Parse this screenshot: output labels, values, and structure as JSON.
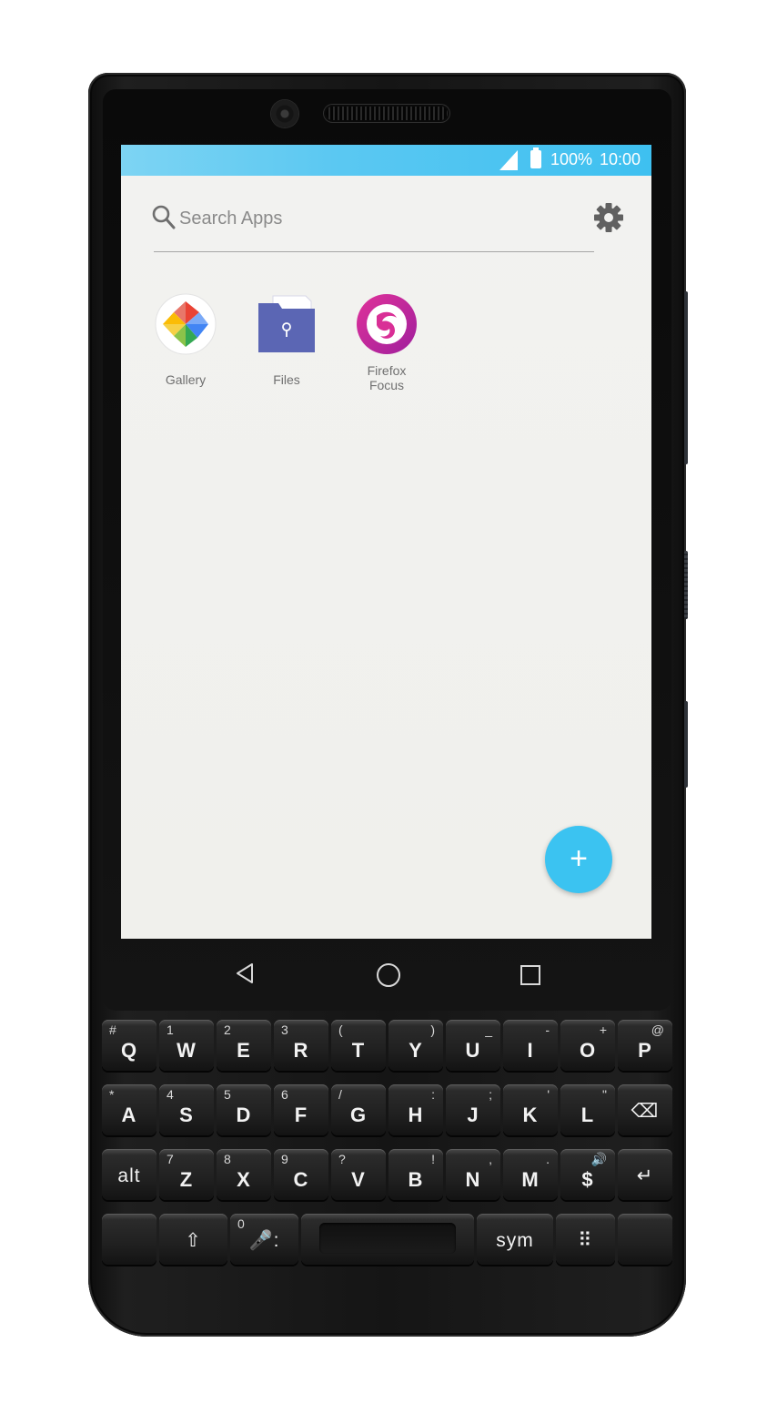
{
  "status_bar": {
    "battery_percent": "100%",
    "time": "10:00",
    "signal_icon": "signal-icon",
    "battery_icon": "battery-icon"
  },
  "search": {
    "placeholder": "Search Apps",
    "icon": "search-icon",
    "settings_icon": "gear-icon"
  },
  "apps": [
    {
      "label": "Gallery",
      "icon": "gallery-pinwheel-icon"
    },
    {
      "label": "Files",
      "icon": "folder-icon"
    },
    {
      "label": "Firefox\nFocus",
      "icon": "firefox-focus-icon"
    }
  ],
  "fab": {
    "label": "+",
    "icon": "plus-icon"
  },
  "nav": {
    "back_icon": "back-icon",
    "home_icon": "home-icon",
    "recent_icon": "recent-apps-icon"
  },
  "keyboard": {
    "row1": [
      {
        "main": "Q",
        "sec": "#"
      },
      {
        "main": "W",
        "sec": "1"
      },
      {
        "main": "E",
        "sec": "2"
      },
      {
        "main": "R",
        "sec": "3"
      },
      {
        "main": "T",
        "sec": "("
      },
      {
        "main": "Y",
        "sec": ")"
      },
      {
        "main": "U",
        "sec": "_"
      },
      {
        "main": "I",
        "sec": "-"
      },
      {
        "main": "O",
        "sec": "+"
      },
      {
        "main": "P",
        "sec": "@"
      }
    ],
    "row2": [
      {
        "main": "A",
        "sec": "*"
      },
      {
        "main": "S",
        "sec": "4"
      },
      {
        "main": "D",
        "sec": "5"
      },
      {
        "main": "F",
        "sec": "6"
      },
      {
        "main": "G",
        "sec": "/"
      },
      {
        "main": "H",
        "sec": ":"
      },
      {
        "main": "J",
        "sec": ";"
      },
      {
        "main": "K",
        "sec": "'"
      },
      {
        "main": "L",
        "sec": "\""
      },
      {
        "main": "⌫",
        "sec": ""
      }
    ],
    "row3": [
      {
        "main": "alt",
        "sec": ""
      },
      {
        "main": "Z",
        "sec": "7"
      },
      {
        "main": "X",
        "sec": "8"
      },
      {
        "main": "C",
        "sec": "9"
      },
      {
        "main": "V",
        "sec": "?"
      },
      {
        "main": "B",
        "sec": "!"
      },
      {
        "main": "N",
        "sec": ","
      },
      {
        "main": "M",
        "sec": "."
      },
      {
        "main": "$",
        "sec": "🔊"
      },
      {
        "main": "↵",
        "sec": ""
      }
    ],
    "row4": [
      {
        "main": "",
        "sec": ""
      },
      {
        "main": "⇧",
        "sec": ""
      },
      {
        "main": "🎤:",
        "sec": "0"
      },
      {
        "main": "",
        "sec": ""
      },
      {
        "main": "sym",
        "sec": ""
      },
      {
        "main": "⠿",
        "sec": ""
      },
      {
        "main": "",
        "sec": ""
      }
    ]
  }
}
